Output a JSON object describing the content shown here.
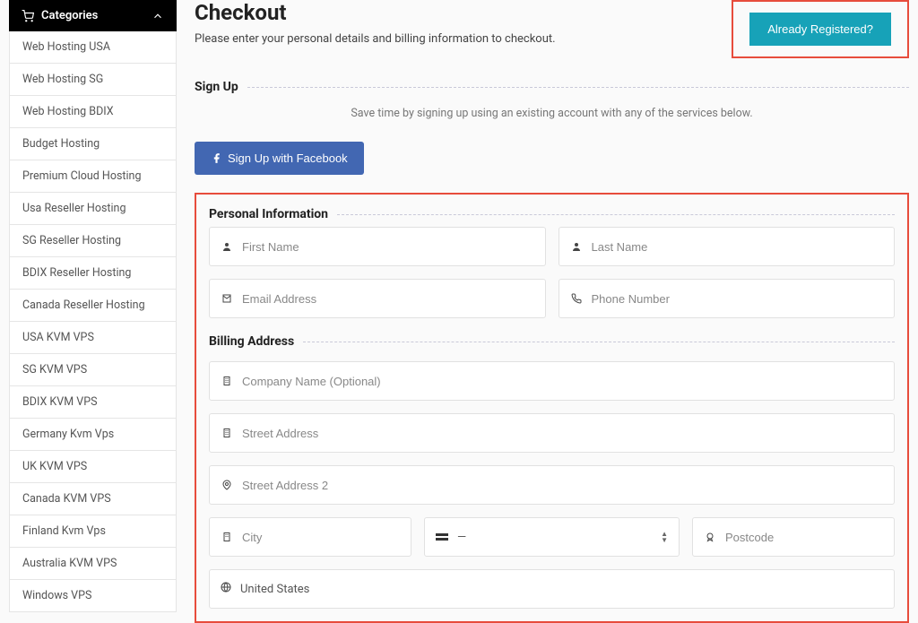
{
  "sidebar": {
    "header": "Categories",
    "items": [
      "Web Hosting USA",
      "Web Hosting SG",
      "Web Hosting BDIX",
      "Budget Hosting",
      "Premium Cloud Hosting",
      "Usa Reseller Hosting",
      "SG Reseller Hosting",
      "BDIX Reseller Hosting",
      "Canada Reseller Hosting",
      "USA KVM VPS",
      "SG KVM VPS",
      "BDIX KVM VPS",
      "Germany Kvm Vps",
      "UK KVM VPS",
      "Canada KVM VPS",
      "Finland Kvm Vps",
      "Australia KVM VPS",
      "Windows VPS"
    ]
  },
  "header": {
    "title": "Checkout",
    "subtitle": "Please enter your personal details and billing information to checkout.",
    "already_registered": "Already Registered?"
  },
  "signup": {
    "title": "Sign Up",
    "hint": "Save time by signing up using an existing account with any of the services below.",
    "facebook_label": "Sign Up with Facebook"
  },
  "sections": {
    "personal": "Personal Information",
    "billing": "Billing Address"
  },
  "fields": {
    "first_name": "First Name",
    "last_name": "Last Name",
    "email": "Email Address",
    "phone": "Phone Number",
    "company": "Company Name (Optional)",
    "street1": "Street Address",
    "street2": "Street Address 2",
    "city": "City",
    "state_placeholder": "—",
    "postcode": "Postcode",
    "country": "United States"
  }
}
